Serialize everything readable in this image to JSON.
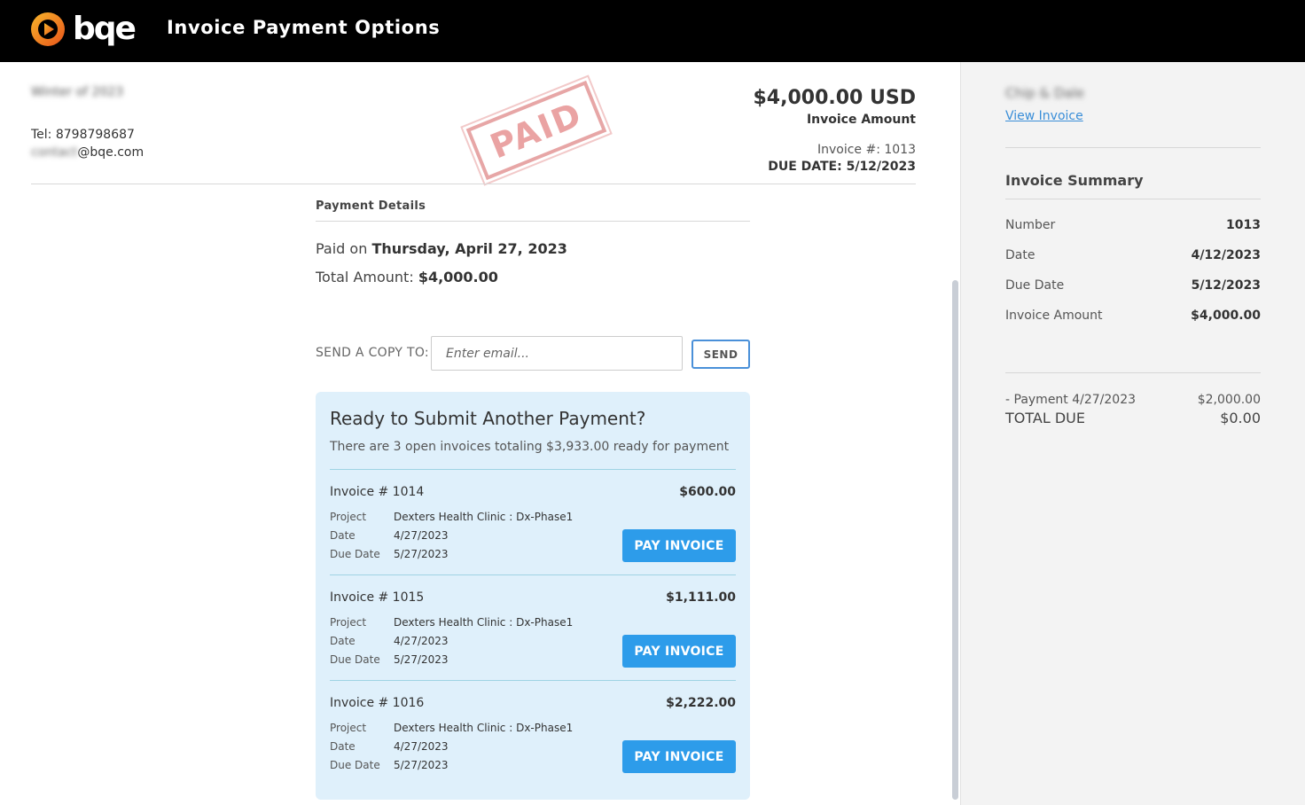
{
  "app": {
    "logo_text": "bqe",
    "title": "Invoice Payment Options"
  },
  "from": {
    "name_redacted": "Winter of 2023",
    "tel": "Tel: 8798798687",
    "email_redacted_part": "contact",
    "email_domain": "@bqe.com"
  },
  "stamp": {
    "text": "PAID"
  },
  "invoice_header": {
    "amount": "$4,000.00 USD",
    "amount_label": "Invoice Amount",
    "invoice_number": "Invoice #: 1013",
    "due_date": "DUE DATE: 5/12/2023"
  },
  "payment_details": {
    "title": "Payment Details",
    "paid_on_prefix": "Paid on ",
    "paid_on_date": "Thursday, April 27, 2023",
    "total_prefix": "Total Amount: ",
    "total_value": "$4,000.00"
  },
  "send_copy": {
    "label": "SEND A COPY TO:",
    "placeholder": "Enter email...",
    "button": "SEND"
  },
  "ready": {
    "title": "Ready to Submit Another Payment?",
    "subtitle": "There are 3 open invoices totaling $3,933.00 ready for payment",
    "field_labels": {
      "project": "Project",
      "date": "Date",
      "due_date": "Due Date"
    },
    "pay_button": "PAY INVOICE",
    "invoices": [
      {
        "title": "Invoice # 1014",
        "amount": "$600.00",
        "project": "Dexters Health Clinic : Dx-Phase1",
        "date": "4/27/2023",
        "due_date": "5/27/2023"
      },
      {
        "title": "Invoice # 1015",
        "amount": "$1,111.00",
        "project": "Dexters Health Clinic : Dx-Phase1",
        "date": "4/27/2023",
        "due_date": "5/27/2023"
      },
      {
        "title": "Invoice # 1016",
        "amount": "$2,222.00",
        "project": "Dexters Health Clinic : Dx-Phase1",
        "date": "4/27/2023",
        "due_date": "5/27/2023"
      }
    ]
  },
  "sidebar": {
    "client_redacted": "Chip & Dale",
    "view_invoice": "View Invoice",
    "summary_title": "Invoice Summary",
    "rows": [
      {
        "label": "Number",
        "value": "1013"
      },
      {
        "label": "Date",
        "value": "4/12/2023"
      },
      {
        "label": "Due Date",
        "value": "5/12/2023"
      },
      {
        "label": "Invoice Amount",
        "value": "$4,000.00"
      }
    ],
    "payment_label": "- Payment 4/27/2023",
    "payment_value": "$2,000.00",
    "total_due_label": "TOTAL DUE",
    "total_due_value": "$0.00"
  },
  "colors": {
    "topbar": "#000000",
    "accent_blue": "#2d9cea",
    "card_bg": "#dff0fb",
    "stamp": "#e7a6a6",
    "logo_orange": "#f39c12"
  }
}
